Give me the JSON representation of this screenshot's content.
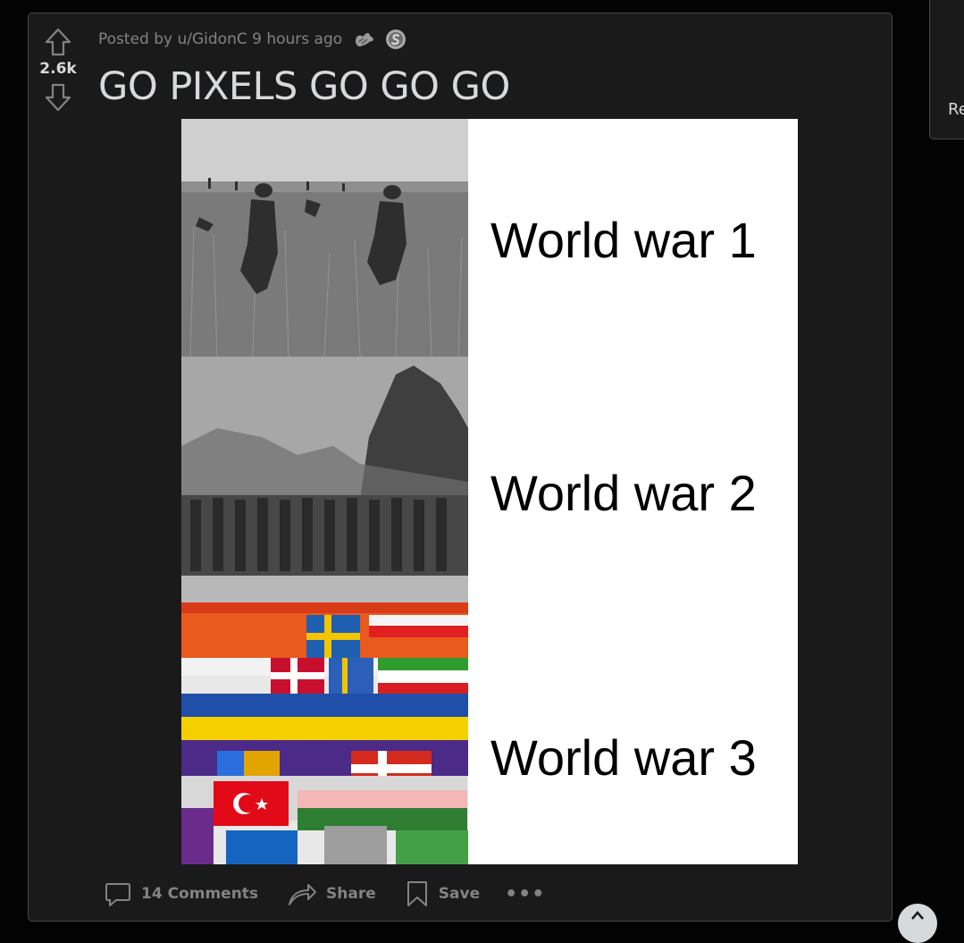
{
  "post": {
    "score": "2.6k",
    "posted_by_prefix": "Posted by ",
    "author": "u/GidonC",
    "time_ago": "9 hours ago",
    "title": "GO PIXELS GO GO GO",
    "awards": [
      "hands-award-icon",
      "silver-coin-award-icon"
    ]
  },
  "media": {
    "panels": [
      {
        "caption": "World war 1",
        "image": "ww1-soldiers-field-photo"
      },
      {
        "caption": "World war 2",
        "image": "ww2-marching-soldiers-photo"
      },
      {
        "caption": "World war 3",
        "image": "r-place-pixel-flags-canvas"
      }
    ]
  },
  "actions": {
    "comments_label": "14 Comments",
    "share_label": "Share",
    "save_label": "Save",
    "more_label": "•••"
  },
  "sidebar": {
    "partial_text": "Re"
  },
  "colors": {
    "page_bg": "#030303",
    "card_bg": "#1a1a1b",
    "border": "#474748",
    "text_primary": "#d7dadc",
    "text_muted": "#818384"
  }
}
